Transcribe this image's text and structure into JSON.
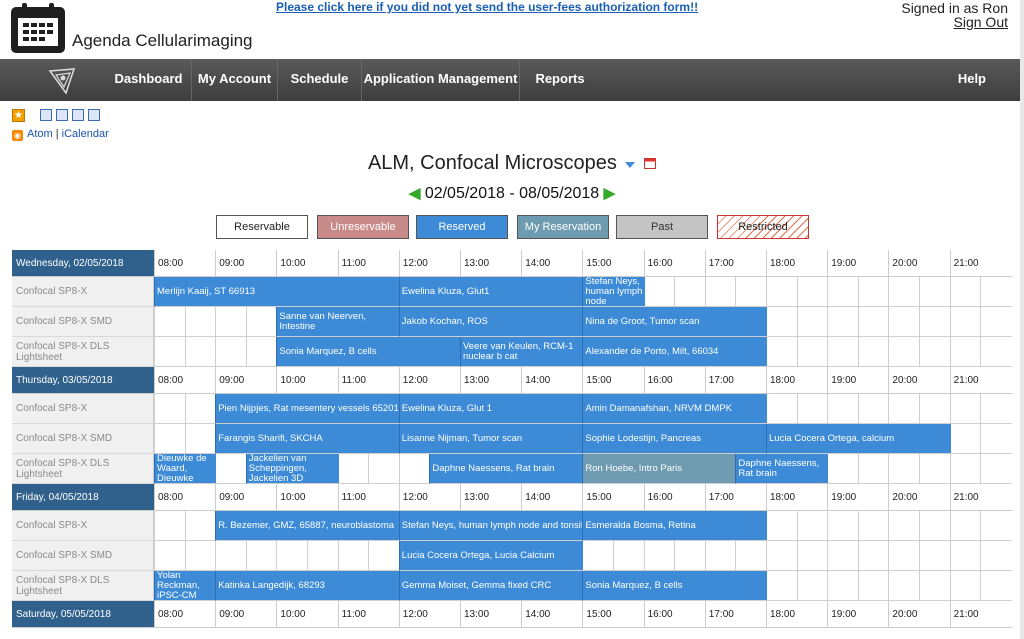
{
  "header": {
    "app_title": "Agenda Cellularimaging",
    "notice_link": "Please click here if you did not yet send the user-fees authorization form!!",
    "signed_in": "Signed in as Ron",
    "sign_out": "Sign Out"
  },
  "nav": {
    "items": [
      "Dashboard",
      "My Account",
      "Schedule",
      "Application Management",
      "Reports"
    ],
    "help": "Help"
  },
  "feeds": {
    "atom": "Atom",
    "separator": "|",
    "ical": "iCalendar"
  },
  "calendar": {
    "title": "ALM, Confocal Microscopes",
    "date_range": "02/05/2018 - 08/05/2018"
  },
  "legend": [
    {
      "label": "Reservable",
      "bg": "#ffffff",
      "color": "#222222"
    },
    {
      "label": "Unreservable",
      "bg": "#c98a8a",
      "color": "#ffffff"
    },
    {
      "label": "Reserved",
      "bg": "#3d8ad6",
      "color": "#ffffff"
    },
    {
      "label": "My Reservation",
      "bg": "#6f9bb0",
      "color": "#ffffff"
    },
    {
      "label": "Past",
      "bg": "#c4c4c4",
      "color": "#333333"
    },
    {
      "label": "Restricted",
      "bg": "#ffffff",
      "color": "#222222"
    }
  ],
  "hours": [
    "08:00",
    "09:00",
    "10:00",
    "11:00",
    "12:00",
    "13:00",
    "14:00",
    "15:00",
    "16:00",
    "17:00",
    "18:00",
    "19:00",
    "20:00",
    "21:00"
  ],
  "days": [
    {
      "label": "Wednesday, 02/05/2018",
      "resources": [
        {
          "name": "Confocal SP8-X",
          "reservations": [
            {
              "start": 0,
              "len": 8,
              "text": "Merlijn Kaaij, ST 66913"
            },
            {
              "start": 8,
              "len": 6,
              "text": "Ewelina Kluza, Glut1"
            },
            {
              "start": 14,
              "len": 2,
              "text": "Stefan Neys, human lymph node"
            }
          ]
        },
        {
          "name": "Confocal SP8-X SMD",
          "reservations": [
            {
              "start": 4,
              "len": 4,
              "text": "Sanne van Neerven, Intestine"
            },
            {
              "start": 8,
              "len": 6,
              "text": "Jakob Kochan, ROS"
            },
            {
              "start": 14,
              "len": 6,
              "text": "Nina de Groot, Tumor scan"
            }
          ]
        },
        {
          "name": "Confocal SP8-X DLS Lightsheet",
          "reservations": [
            {
              "start": 4,
              "len": 6,
              "text": "Sonia Marquez, B cells"
            },
            {
              "start": 10,
              "len": 4,
              "text": "Veere van Keulen, RCM-1 nuclear b cat"
            },
            {
              "start": 14,
              "len": 6,
              "text": "Alexander de Porto, Milt, 66034"
            }
          ]
        }
      ]
    },
    {
      "label": "Thursday, 03/05/2018",
      "resources": [
        {
          "name": "Confocal SP8-X",
          "reservations": [
            {
              "start": 2,
              "len": 6,
              "text": "Pien Nijpjes, Rat mesentery vessels 65201"
            },
            {
              "start": 8,
              "len": 6,
              "text": "Ewelina Kluza, Glut 1"
            },
            {
              "start": 14,
              "len": 6,
              "text": "Amin Damanafshan, NRVM DMPK"
            }
          ]
        },
        {
          "name": "Confocal SP8-X SMD",
          "reservations": [
            {
              "start": 2,
              "len": 6,
              "text": "Farangis Sharifi, SKCHA"
            },
            {
              "start": 8,
              "len": 6,
              "text": "Lisanne Nijman, Tumor scan"
            },
            {
              "start": 14,
              "len": 6,
              "text": "Sophie Lodestijn, Pancreas"
            },
            {
              "start": 20,
              "len": 6,
              "text": "Lucia Cocera Ortega, calcium"
            }
          ]
        },
        {
          "name": "Confocal SP8-X DLS Lightsheet",
          "reservations": [
            {
              "start": 0,
              "len": 2,
              "text": "Dieuwke de Waard, Dieuwke"
            },
            {
              "start": 3,
              "len": 3,
              "text": "Jackelien van Scheppingen, Jackelien 3D"
            },
            {
              "start": 9,
              "len": 5,
              "text": "Daphne Naessens, Rat brain"
            },
            {
              "start": 14,
              "len": 5,
              "text": "Ron Hoebe, Intro Paris",
              "mine": true
            },
            {
              "start": 19,
              "len": 3,
              "text": "Daphne Naessens, Rat brain"
            }
          ]
        }
      ]
    },
    {
      "label": "Friday, 04/05/2018",
      "resources": [
        {
          "name": "Confocal SP8-X",
          "reservations": [
            {
              "start": 2,
              "len": 6,
              "text": "R. Bezemer, GMZ, 65887, neuroblastoma"
            },
            {
              "start": 8,
              "len": 6,
              "text": "Stefan Neys, human lymph node and tonsil"
            },
            {
              "start": 14,
              "len": 6,
              "text": "Esmeralda Bosma, Retina"
            }
          ]
        },
        {
          "name": "Confocal SP8-X SMD",
          "reservations": [
            {
              "start": 8,
              "len": 6,
              "text": "Lucia Cocera Ortega, Lucia Calcium"
            }
          ]
        },
        {
          "name": "Confocal SP8-X DLS Lightsheet",
          "reservations": [
            {
              "start": 0,
              "len": 2,
              "text": "Yolan Reckman, iPSC-CM"
            },
            {
              "start": 2,
              "len": 6,
              "text": "Katinka Langedijk, 68293"
            },
            {
              "start": 8,
              "len": 6,
              "text": "Gemma Moiset, Gemma fixed CRC"
            },
            {
              "start": 14,
              "len": 6,
              "text": "Sonia Marquez, B cells"
            }
          ]
        }
      ]
    },
    {
      "label": "Saturday, 05/05/2018",
      "resources": []
    }
  ]
}
